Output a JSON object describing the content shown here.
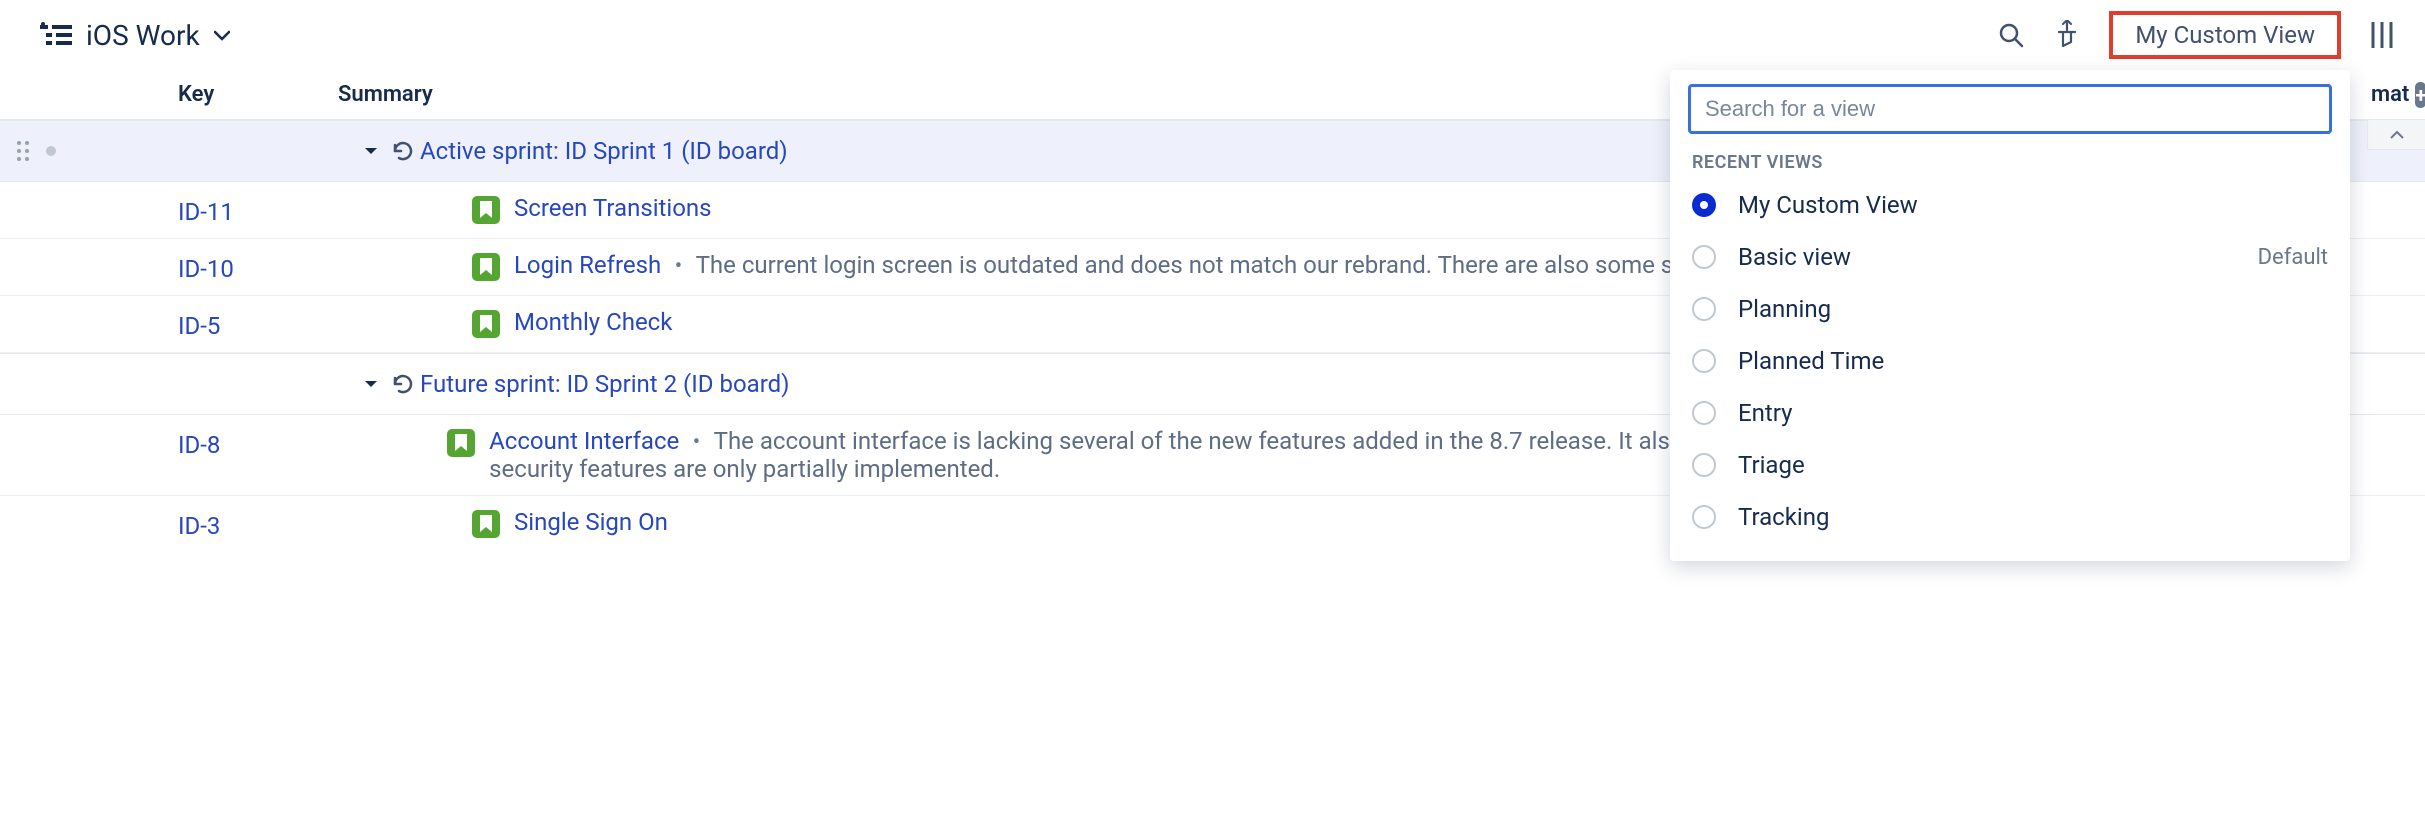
{
  "header": {
    "board_title": "iOS Work",
    "custom_view_button": "My Custom View",
    "estimate_col_text": "mat"
  },
  "columns": {
    "key": "Key",
    "summary": "Summary"
  },
  "groups": [
    {
      "title": "Active sprint: ID Sprint 1 (ID board)",
      "kind": "active",
      "issues": [
        {
          "key": "ID-11",
          "title": "Screen Transitions",
          "desc": ""
        },
        {
          "key": "ID-10",
          "title": "Login Refresh",
          "desc": "The current login screen is outdated and does not match our rebrand. There are also some security concerns that should be address in this refres"
        },
        {
          "key": "ID-5",
          "title": "Monthly Check",
          "desc": ""
        }
      ]
    },
    {
      "title": "Future sprint: ID Sprint 2 (ID board)",
      "kind": "future",
      "issues": [
        {
          "key": "ID-8",
          "title": "Account Interface",
          "desc": "The account interface is lacking several of the new features added in the 8.7 release. It also needs to be updated for the rebrand. Additionally, t new security features are only partially implemented."
        },
        {
          "key": "ID-3",
          "title": "Single Sign On",
          "desc": ""
        }
      ]
    }
  ],
  "dropdown": {
    "search_placeholder": "Search for a view",
    "section_title": "RECENT VIEWS",
    "default_badge": "Default",
    "items": [
      {
        "label": "My Custom View",
        "selected": true
      },
      {
        "label": "Basic view",
        "default": true
      },
      {
        "label": "Planning"
      },
      {
        "label": "Planned Time"
      },
      {
        "label": "Entry"
      },
      {
        "label": "Triage"
      },
      {
        "label": "Tracking"
      }
    ]
  }
}
